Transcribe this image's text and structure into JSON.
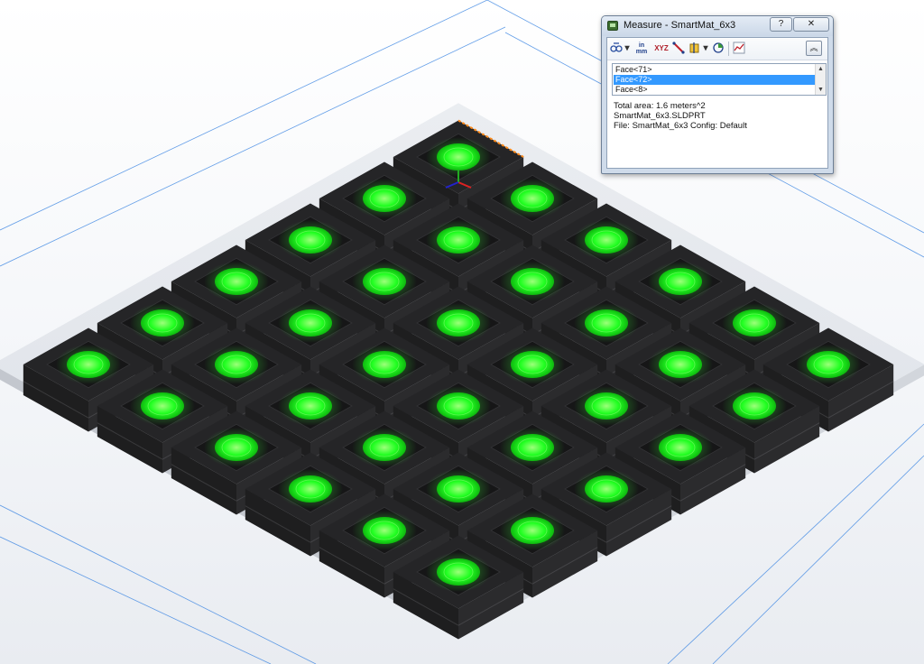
{
  "viewport": {
    "background_color": "#f2f4f7",
    "button_color": "#111111",
    "led_color": "#22ff22",
    "guide_line_color": "#2f7de0",
    "grid_rows": 6,
    "grid_cols": 6
  },
  "dialog": {
    "title": "Measure - SmartMat_6x3",
    "title_icon": "measure-tape-icon",
    "help_label": "?",
    "close_label": "✕",
    "toolbar": {
      "icons": [
        "arc-circle-options-icon",
        "dropdown-arrow-icon",
        "units-precision-icon",
        "xyz-dimensions-icon",
        "point-to-point-icon",
        "projection-on-icon",
        "dropdown-arrow-icon",
        "mass-properties-icon",
        "measurement-history-icon"
      ],
      "units_top": "in",
      "units_bottom": "mm",
      "xyz_label": "XYZ",
      "collapse_label": "︽"
    },
    "selection_list": [
      {
        "label": "Face<71>",
        "selected": false
      },
      {
        "label": "Face<72>",
        "selected": true
      },
      {
        "label": "Face<8>",
        "selected": false
      }
    ],
    "results": {
      "total_area": "Total area: 1.6 meters^2",
      "file_name": "SmartMat_6x3.SLDPRT",
      "file_config": "File: SmartMat_6x3 Config: Default"
    }
  }
}
